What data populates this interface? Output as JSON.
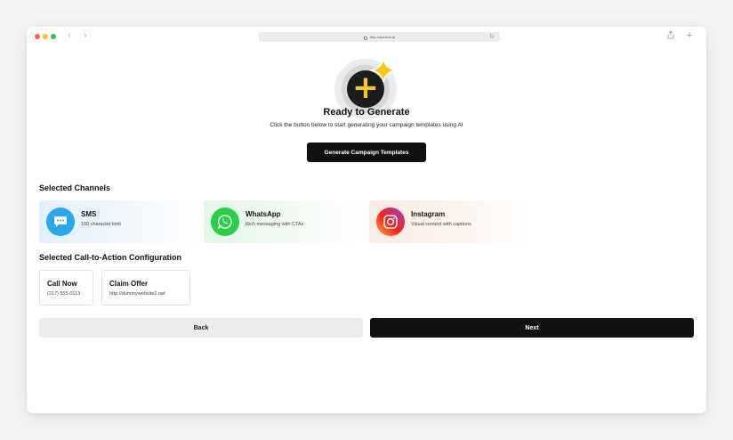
{
  "browser": {
    "url": "mlp.supernal.ai",
    "back_icon": "chevron-left-icon",
    "forward_icon": "chevron-right-icon",
    "share_icon": "share-icon",
    "new_tab_icon": "plus-icon"
  },
  "hero": {
    "icon": "sparkle-plus-icon",
    "title": "Ready to Generate",
    "subtitle": "Click the button below to start generating your campaign templates using AI",
    "button_label": "Generate Campaign Templates"
  },
  "channels": {
    "heading": "Selected Channels",
    "items": [
      {
        "name": "SMS",
        "description": "160 character limit",
        "icon": "message-bubble-icon",
        "color": "#2aa8ee"
      },
      {
        "name": "WhatsApp",
        "description": "Rich messaging with CTAs",
        "icon": "whatsapp-icon",
        "color": "#27d045"
      },
      {
        "name": "Instagram",
        "description": "Visual content with captions",
        "icon": "instagram-icon",
        "color": "#e1306c"
      }
    ]
  },
  "cta_config": {
    "heading": "Selected Call-to-Action Configuration",
    "items": [
      {
        "title": "Call Now",
        "value": "(217) 555-0113"
      },
      {
        "title": "Claim Offer",
        "value": "http://dummywebsite2.net"
      }
    ]
  },
  "footer": {
    "back_label": "Back",
    "next_label": "Next"
  },
  "colors": {
    "primary": "#111111",
    "accent": "#f8c81c",
    "secondary_button": "#ececed"
  }
}
